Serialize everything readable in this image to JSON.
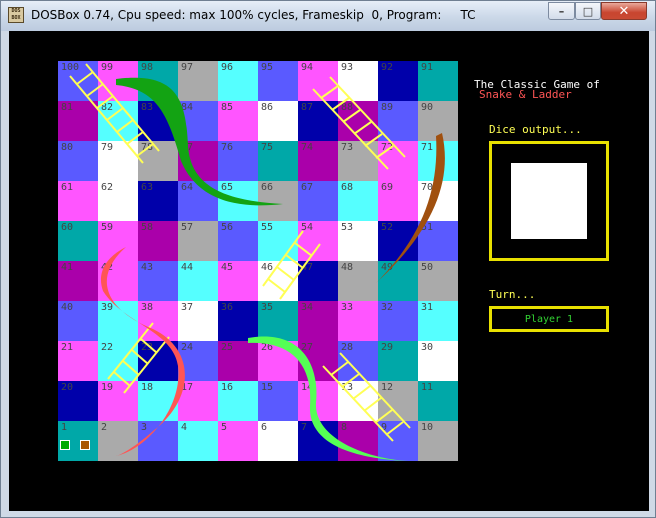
{
  "window": {
    "title": "DOSBox 0.74, Cpu speed: max 100% cycles, Frameskip  0, Program:     TC",
    "icon_text": "DOS BOX",
    "controls": {
      "minimize": "–",
      "maximize": "□",
      "close": "✕"
    }
  },
  "game": {
    "heading_line1": "The Classic Game of",
    "heading_line2": "Snake & Ladder",
    "dice_label": "Dice output...",
    "turn_label": "Turn...",
    "player_label": "Player 1",
    "colors": {
      "heading": "#ffffff",
      "accent": "#ff5555",
      "label": "#ffff55",
      "frame": "#e8e000",
      "player": "#33d433"
    }
  },
  "board": {
    "rows": [
      {
        "numbers": [
          "100",
          "99",
          "98",
          "97",
          "96",
          "95",
          "94",
          "93",
          "92",
          "91"
        ],
        "colors": [
          "#5a5aff",
          "#ff55ff",
          "#00a8a8",
          "#aaaaaa",
          "#55ffff",
          "#5a5aff",
          "#ff55ff",
          "#ffffff",
          "#0000aa",
          "#00a8a8"
        ]
      },
      {
        "numbers": [
          "81",
          "82",
          "83",
          "84",
          "85",
          "86",
          "87",
          "88",
          "89",
          "90"
        ],
        "colors": [
          "#aa00aa",
          "#55ffff",
          "#0000aa",
          "#5a5aff",
          "#ff55ff",
          "#ffffff",
          "#0000aa",
          "#aa00aa",
          "#5a5aff",
          "#aaaaaa"
        ]
      },
      {
        "numbers": [
          "80",
          "79",
          "78",
          "77",
          "76",
          "75",
          "74",
          "73",
          "72",
          "71"
        ],
        "colors": [
          "#5a5aff",
          "#ffffff",
          "#aaaaaa",
          "#aa00aa",
          "#5a5aff",
          "#00a8a8",
          "#aa00aa",
          "#aaaaaa",
          "#ff55ff",
          "#55ffff"
        ]
      },
      {
        "numbers": [
          "61",
          "62",
          "63",
          "64",
          "65",
          "66",
          "67",
          "68",
          "69",
          "70"
        ],
        "colors": [
          "#ff55ff",
          "#ffffff",
          "#0000aa",
          "#5a5aff",
          "#55ffff",
          "#aaaaaa",
          "#5a5aff",
          "#55ffff",
          "#ff55ff",
          "#ffffff"
        ]
      },
      {
        "numbers": [
          "60",
          "59",
          "58",
          "57",
          "56",
          "55",
          "54",
          "53",
          "52",
          "51"
        ],
        "colors": [
          "#00a8a8",
          "#ff55ff",
          "#aa00aa",
          "#aaaaaa",
          "#5a5aff",
          "#55ffff",
          "#ff55ff",
          "#ffffff",
          "#0000aa",
          "#5a5aff"
        ]
      },
      {
        "numbers": [
          "41",
          "42",
          "43",
          "44",
          "45",
          "46",
          "47",
          "48",
          "49",
          "50"
        ],
        "colors": [
          "#aa00aa",
          "#ff55ff",
          "#5a5aff",
          "#55ffff",
          "#ff55ff",
          "#ffffff",
          "#0000aa",
          "#aaaaaa",
          "#00a8a8",
          "#aaaaaa"
        ]
      },
      {
        "numbers": [
          "40",
          "39",
          "38",
          "37",
          "36",
          "35",
          "34",
          "33",
          "32",
          "31"
        ],
        "colors": [
          "#5a5aff",
          "#55ffff",
          "#ff55ff",
          "#ffffff",
          "#0000aa",
          "#00a8a8",
          "#aa00aa",
          "#ff55ff",
          "#5a5aff",
          "#55ffff"
        ]
      },
      {
        "numbers": [
          "21",
          "22",
          "23",
          "24",
          "25",
          "26",
          "27",
          "28",
          "29",
          "30"
        ],
        "colors": [
          "#ff55ff",
          "#55ffff",
          "#0000aa",
          "#5a5aff",
          "#aa00aa",
          "#ff55ff",
          "#aa00aa",
          "#5a5aff",
          "#00a8a8",
          "#ffffff"
        ]
      },
      {
        "numbers": [
          "20",
          "19",
          "18",
          "17",
          "16",
          "15",
          "14",
          "13",
          "12",
          "11"
        ],
        "colors": [
          "#0000aa",
          "#ff55ff",
          "#55ffff",
          "#ff55ff",
          "#55ffff",
          "#5a5aff",
          "#ff55ff",
          "#ffffff",
          "#aaaaaa",
          "#00a8a8"
        ]
      },
      {
        "numbers": [
          "1",
          "2",
          "3",
          "4",
          "5",
          "6",
          "7",
          "8",
          "9",
          "10"
        ],
        "colors": [
          "#00a8a8",
          "#aaaaaa",
          "#5a5aff",
          "#55ffff",
          "#ff55ff",
          "#ffffff",
          "#0000aa",
          "#aa00aa",
          "#5a5aff",
          "#aaaaaa"
        ]
      }
    ],
    "tokens": [
      {
        "player": "1",
        "color": "#00aa00"
      },
      {
        "player": "2",
        "color": "#aa5500"
      }
    ],
    "snake_colors": {
      "green": "#13a313",
      "brown": "#a0500f",
      "red": "#ff5555",
      "light_green": "#55ff55"
    },
    "ladder_color": "#ffff55"
  }
}
